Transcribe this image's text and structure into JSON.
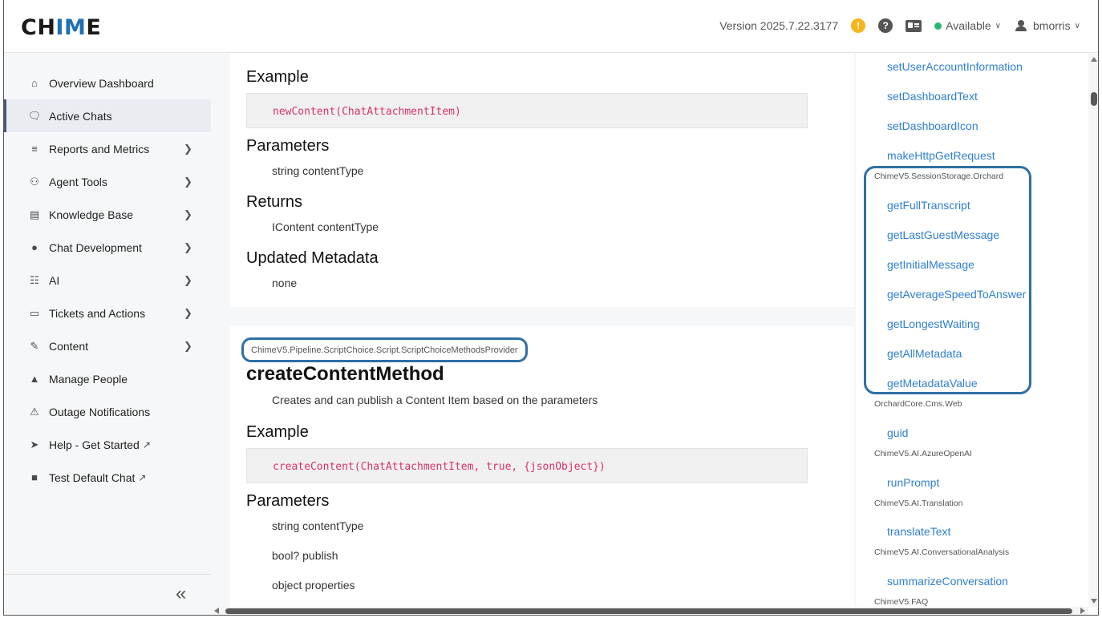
{
  "header": {
    "logo_prefix": "CH",
    "logo_accent": "IM",
    "logo_suffix": "E",
    "version": "Version 2025.7.22.3177",
    "warning_glyph": "!",
    "help_glyph": "?",
    "status_label": "Available",
    "user_name": "bmorris"
  },
  "sidebar": {
    "items": [
      {
        "label": "Overview Dashboard",
        "icon": "home-icon"
      },
      {
        "label": "Active Chats",
        "icon": "chats-icon"
      },
      {
        "label": "Reports and Metrics",
        "icon": "chart-icon"
      },
      {
        "label": "Agent Tools",
        "icon": "users-icon"
      },
      {
        "label": "Knowledge Base",
        "icon": "book-icon"
      },
      {
        "label": "Chat Development",
        "icon": "chat-bubble-icon"
      },
      {
        "label": "AI",
        "icon": "robot-icon"
      },
      {
        "label": "Tickets and Actions",
        "icon": "ticket-icon"
      },
      {
        "label": "Content",
        "icon": "edit-icon"
      },
      {
        "label": "Manage People",
        "icon": "person-icon"
      },
      {
        "label": "Outage Notifications",
        "icon": "warning-icon"
      },
      {
        "label": "Help - Get Started",
        "icon": "rocket-icon"
      },
      {
        "label": "Test Default Chat",
        "icon": "chat-square-icon"
      }
    ],
    "ext_glyph": "↗",
    "collapse_glyph": "«"
  },
  "main": {
    "card1": {
      "example_heading": "Example",
      "example_code": "newContent(ChatAttachmentItem)",
      "parameters_heading": "Parameters",
      "param_1": "string contentType",
      "returns_heading": "Returns",
      "returns_value": "IContent contentType",
      "metadata_heading": "Updated Metadata",
      "metadata_value": "none"
    },
    "card2": {
      "namespace": "ChimeV5.Pipeline.ScriptChoice.Script.ScriptChoiceMethodsProvider",
      "title": "createContentMethod",
      "description": "Creates and can publish a Content Item based on the parameters",
      "example_heading": "Example",
      "example_code": "createContent(ChatAttachmentItem, true, {jsonObject})",
      "parameters_heading": "Parameters",
      "param_1": "string contentType",
      "param_2": "bool? publish",
      "param_3": "object properties"
    }
  },
  "toc": {
    "link_1": "setUserAccountInformation",
    "link_2": "setDashboardText",
    "link_3": "setDashboardIcon",
    "link_4": "makeHttpGetRequest",
    "group_1": "ChimeV5.SessionStorage.Orchard",
    "link_5": "getFullTranscript",
    "link_6": "getLastGuestMessage",
    "link_7": "getInitialMessage",
    "link_8": "getAverageSpeedToAnswer",
    "link_9": "getLongestWaiting",
    "link_10": "getAllMetadata",
    "link_11": "getMetadataValue",
    "group_2": "OrchardCore.Cms.Web",
    "link_12": "guid",
    "group_3": "ChimeV5.AI.AzureOpenAI",
    "link_13": "runPrompt",
    "group_4": "ChimeV5.AI.Translation",
    "link_14": "translateText",
    "group_5": "ChimeV5.AI.ConversationalAnalysis",
    "link_15": "summarizeConversation",
    "group_6": "ChimeV5.FAQ"
  },
  "colors": {
    "accent": "#1f6fb5",
    "link": "#2f7fd1",
    "highlight_border": "#2f6fa3",
    "code_text": "#d6336c",
    "status_available": "#2bb673",
    "warning": "#f5b51e"
  }
}
